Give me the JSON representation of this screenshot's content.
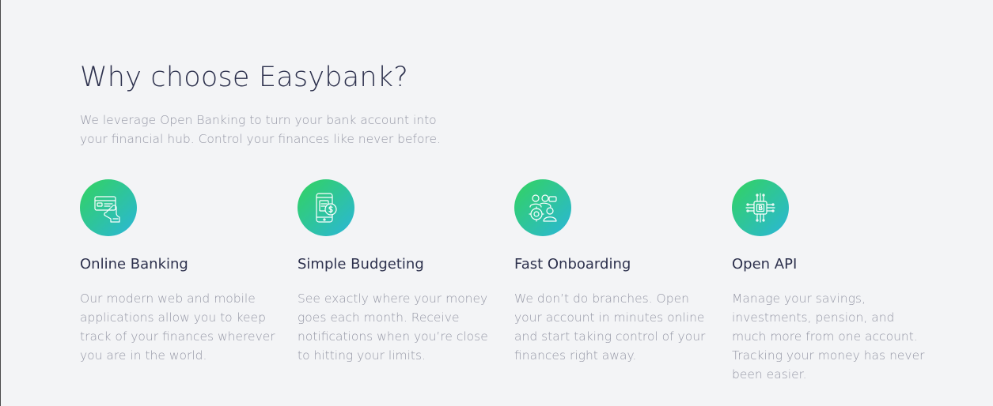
{
  "section": {
    "title": "Why choose Easybank?",
    "intro": "We leverage Open Banking to turn your bank account into your financial hub. Control your finances like never before."
  },
  "features": [
    {
      "icon": "online-banking-icon",
      "title": "Online Banking",
      "text": "Our modern web and mobile applications allow you to keep track of your finances wherever you are in the world."
    },
    {
      "icon": "budgeting-icon",
      "title": "Simple Budgeting",
      "text": "See exactly where your money goes each month. Receive notifications when you’re close to hitting your limits."
    },
    {
      "icon": "onboarding-icon",
      "title": "Fast Onboarding",
      "text": "We don’t do branches. Open your account in minutes online and start taking control of your finances right away."
    },
    {
      "icon": "api-icon",
      "title": "Open API",
      "text": "Manage your savings, investments, pension, and much more from one account. Tracking your money has never been easier."
    }
  ],
  "colors": {
    "background": "#f3f4f6",
    "heading": "#2d314d",
    "body_text": "#9698a6",
    "gradient_start": "#33d35e",
    "gradient_end": "#2ab6d9"
  }
}
